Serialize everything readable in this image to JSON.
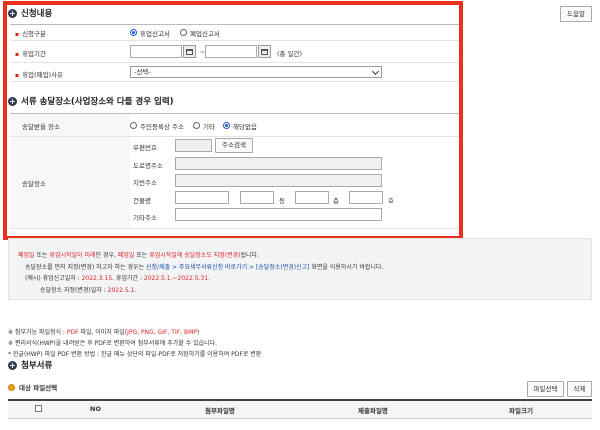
{
  "section1": {
    "title": "신청내용",
    "help_button": "도움말"
  },
  "apply_type": {
    "label": "신청구분",
    "options": [
      "휴업신고서",
      "폐업신고서"
    ],
    "selected": "휴업신고서"
  },
  "period": {
    "label": "휴업기간",
    "separator": "~",
    "days_text": "(총   일간)"
  },
  "reason": {
    "label": "휴업(폐업)사유",
    "selected": "-선택-"
  },
  "section2": {
    "title": "서류 송달장소(사업장소와 다를 경우 입력)"
  },
  "delivery_place": {
    "label": "송달받을 장소",
    "options": [
      "주민등록상 주소",
      "기타",
      "해당없음"
    ],
    "selected": "해당없음"
  },
  "address": {
    "label": "송달장소",
    "postcode_label": "우편번호",
    "search_button": "주소검색",
    "road_label": "도로명주소",
    "jibun_label": "지번주소",
    "building_label": "건물명",
    "dong_suffix": "동",
    "floor_suffix": "층",
    "ho_suffix": "호",
    "etc_label": "기타주소"
  },
  "notice": {
    "l1_a": "폐업일",
    "l1_b": " 또는 ",
    "l1_c": "휴업시작일이 미래",
    "l1_d": "인 경우, ",
    "l1_e": "폐업일",
    "l1_f": " 또는 ",
    "l1_g": "휴업시작일에 송달장소도 지정(변경)",
    "l1_h": "됩니다.",
    "l2_a": "송달장소를 먼저 지정(변경) 하고자 하는 경우는 ",
    "l2_b": "신청/제출 > 주요세무서류신청 바로가기 > [송달장소(변경)신고]",
    "l2_c": " 화면을 이용하시기 바랍니다.",
    "l3_a": "(예시) 휴업신고일자 : ",
    "l3_b": "2022.3.15.",
    "l3_c": "    휴업기간 : ",
    "l3_d": "2022.5.1.~2022.5.31.",
    "l4_a": "송달장소 지정(변경)일자 : ",
    "l4_b": "2022.5.1."
  },
  "attach_info": {
    "l1_a": "※ 첨부가능 파일형식 : ",
    "l1_b": "PDF",
    "l1_c": " 파일, 이미지 파일(",
    "l1_d": "JPG, PNG, GIF, TIF, BMP",
    "l1_e": ")",
    "l2": "※ 편리서식(HWP)을 내려받은 후 PDF로 변환하여 첨부서류에 추가할 수 있습니다.",
    "l3": "* 한글(HWP) 파일 PDF 변환 방법 : 한글 메뉴 상단의 파일-PDF로 저장하기를 이용하여 PDF로 변환"
  },
  "section3": {
    "title": "첨부서류"
  },
  "target": {
    "title": "대상 파일선택",
    "select_button": "파일선택",
    "delete_button": "삭제"
  },
  "table": {
    "headers": [
      "NO",
      "첨부파일명",
      "제출파일명",
      "파일크기"
    ]
  }
}
